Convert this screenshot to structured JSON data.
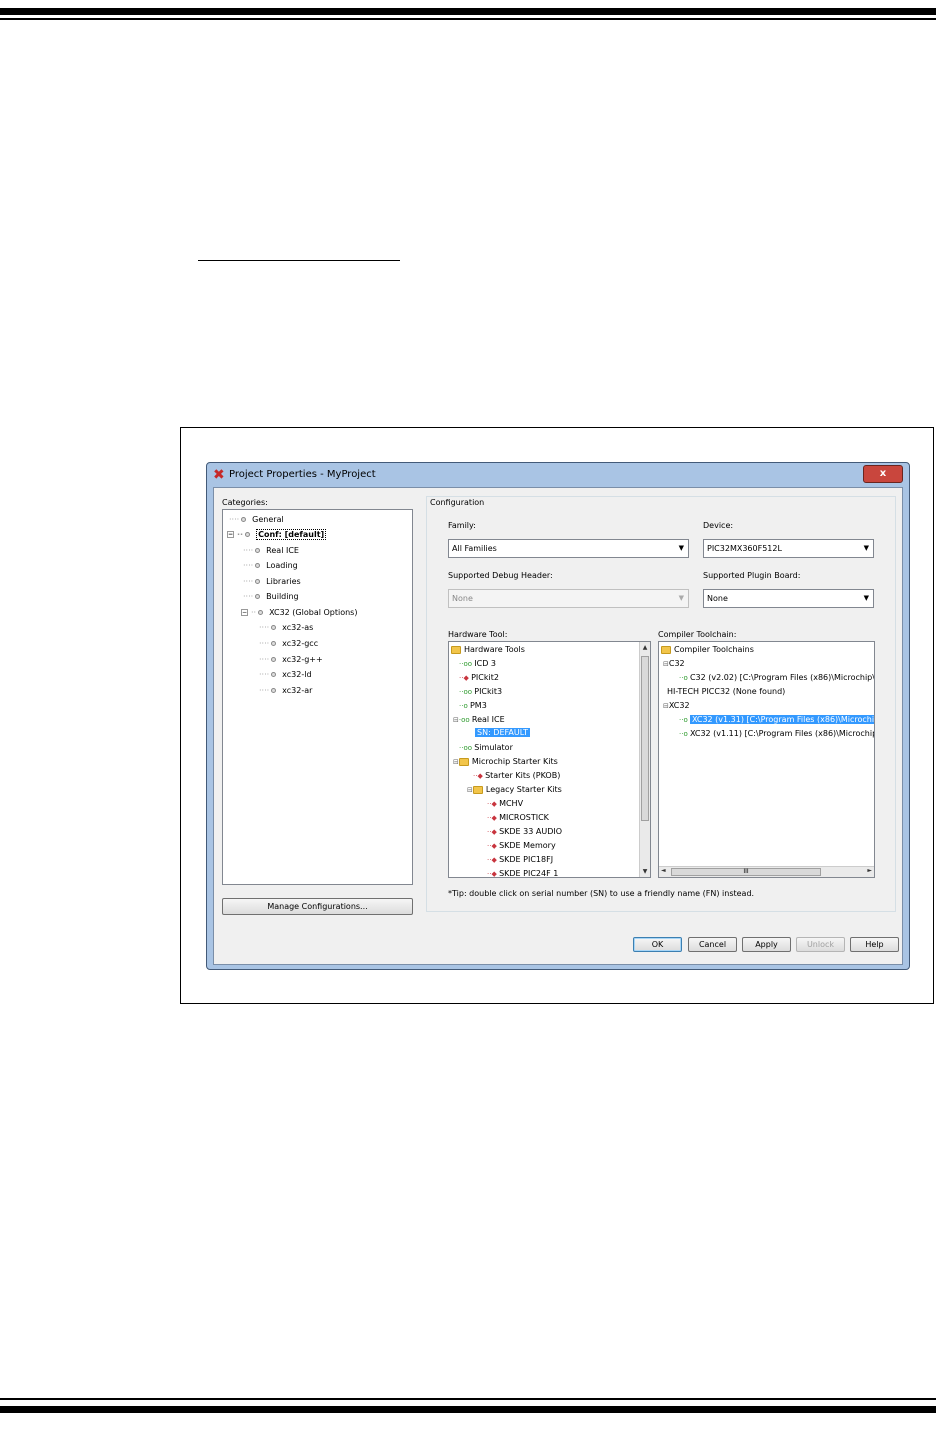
{
  "dialog": {
    "title": "Project Properties - MyProject",
    "close_label": "x",
    "categories_label": "Categories:",
    "categories": [
      {
        "label": "General",
        "bold": false
      },
      {
        "label": "Conf: [default]",
        "bold": true
      },
      {
        "label": "Real ICE",
        "bold": false
      },
      {
        "label": "Loading",
        "bold": false
      },
      {
        "label": "Libraries",
        "bold": false
      },
      {
        "label": "Building",
        "bold": false
      },
      {
        "label": "XC32 (Global Options)",
        "bold": false
      },
      {
        "label": "xc32-as",
        "bold": false
      },
      {
        "label": "xc32-gcc",
        "bold": false
      },
      {
        "label": "xc32-g++",
        "bold": false
      },
      {
        "label": "xc32-ld",
        "bold": false
      },
      {
        "label": "xc32-ar",
        "bold": false
      }
    ],
    "manage_configurations": "Manage Configurations...",
    "configuration_label": "Configuration",
    "family_label": "Family:",
    "family_value": "All Families",
    "device_label": "Device:",
    "device_value": "PIC32MX360F512L",
    "debug_header_label": "Supported Debug Header:",
    "debug_header_value": "None",
    "plugin_board_label": "Supported Plugin Board:",
    "plugin_board_value": "None",
    "hardware_tool_label": "Hardware Tool:",
    "hardware_tools": [
      "Hardware Tools",
      "ICD 3",
      "PICkit2",
      "PICkit3",
      "PM3",
      "Real ICE",
      "SN: DEFAULT",
      "Simulator",
      "Microchip Starter Kits",
      "Starter Kits (PKOB)",
      "Legacy Starter Kits",
      "MCHV",
      "MICROSTICK",
      "SKDE 33 AUDIO",
      "SKDE Memory",
      "SKDE PIC18FJ",
      "SKDE PIC24F 1"
    ],
    "compiler_toolchain_label": "Compiler Toolchain:",
    "compiler_toolchains": [
      "Compiler Toolchains",
      "C32",
      "C32 (v2.02) [C:\\Program Files (x86)\\Microchip\\M",
      "HI-TECH PICC32 (None found)",
      "XC32",
      "XC32 (v1.31) [C:\\Program Files (x86)\\Microchip\\",
      "XC32 (v1.11) [C:\\Program Files (x86)\\Microchip\\"
    ],
    "hscroll_grip": "III",
    "tip": "*Tip: double click on serial number (SN) to use a friendly name (FN) instead.",
    "buttons": {
      "ok": "OK",
      "cancel": "Cancel",
      "apply": "Apply",
      "unlock": "Unlock",
      "help": "Help"
    }
  },
  "colors": {
    "selection": "#3399ff",
    "frame": "#a9c4e4",
    "connected_green": "#2e9b2e",
    "disconnected_red": "#c8343e"
  }
}
